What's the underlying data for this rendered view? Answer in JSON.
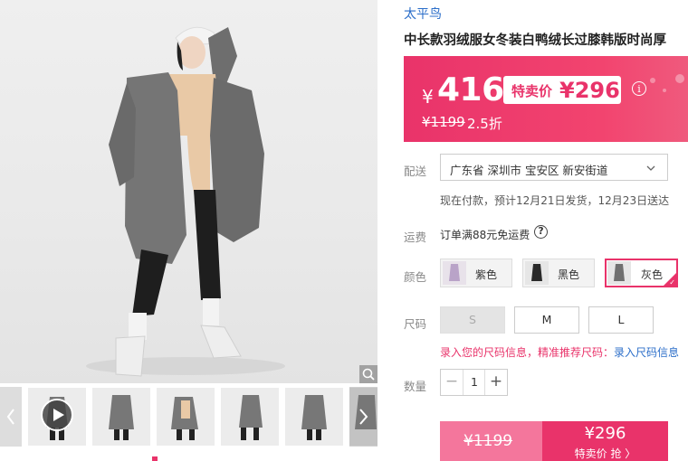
{
  "brand": "太平鸟",
  "product_title": "中长款羽绒服女冬装白鸭绒长过膝韩版时尚厚",
  "price": {
    "current_yen": "¥",
    "current": "416",
    "promo_label": "特卖价",
    "promo_price": "¥296",
    "original": "¥1199",
    "discount": "2.5折",
    "info_icon": "i"
  },
  "delivery": {
    "label": "配送",
    "address": "广东省 深圳市 宝安区 新安街道",
    "note": "现在付款，预计12月21日发货，12月23日送达"
  },
  "freight": {
    "label": "运费",
    "text": "订单满88元免运费",
    "help_icon": "?"
  },
  "color": {
    "label": "颜色",
    "options": [
      {
        "name": "紫色",
        "selected": false
      },
      {
        "name": "黑色",
        "selected": false
      },
      {
        "name": "灰色",
        "selected": true
      }
    ]
  },
  "size": {
    "label": "尺码",
    "options": [
      {
        "name": "S",
        "disabled": true
      },
      {
        "name": "M",
        "disabled": false
      },
      {
        "name": "L",
        "disabled": false
      }
    ],
    "note": "录入您的尺码信息，精准推荐尺码：",
    "note_link": "录入尺码信息"
  },
  "quantity": {
    "label": "数量",
    "value": "1",
    "minus": "−",
    "plus": "+"
  },
  "buy_bar": {
    "original": "¥1199",
    "promo_price": "¥296",
    "promo_label": "特卖价 抢 〉"
  },
  "icons": {
    "zoom": "magnifier-icon",
    "play": "play-icon",
    "prev": "chevron-left-icon",
    "next": "chevron-right-icon"
  },
  "colors": {
    "accent": "#e9336a",
    "link": "#2b6ec9"
  }
}
